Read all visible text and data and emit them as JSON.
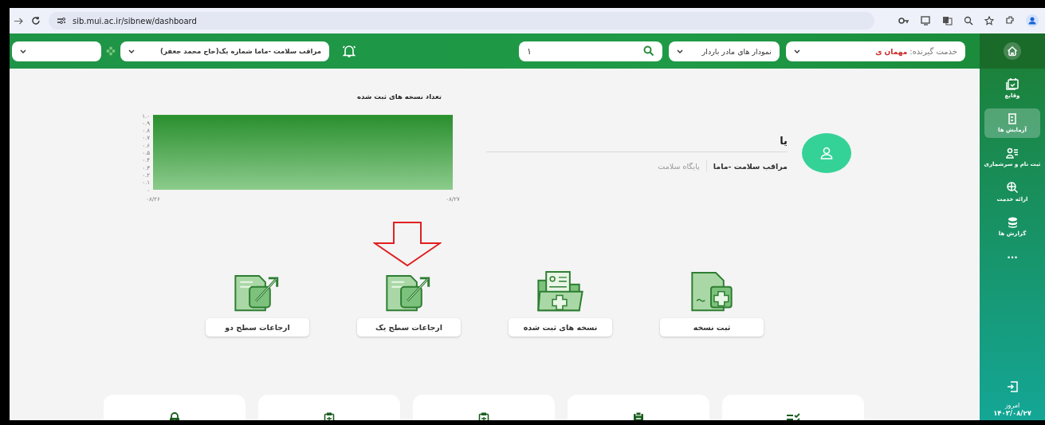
{
  "browser": {
    "url": "sib.mui.ac.ir/sibnew/dashboard"
  },
  "header": {
    "client_label": "خدمت گیرنده:",
    "client_value": "مهمان ی",
    "chart_select": "نمودار های مادر باردار",
    "search_value": "۱",
    "role_select": "مراقب سلامت -ماما شماره یک(حاج محمد جعفر)"
  },
  "sidebar": {
    "items": [
      {
        "label": "وقایع",
        "kind": "calendar",
        "selected": false
      },
      {
        "label": "آزمایش ها",
        "kind": "tube",
        "selected": true
      },
      {
        "label": "ثبت نام و سرشماری",
        "kind": "people",
        "selected": false
      },
      {
        "label": "ارائه خدمت",
        "kind": "globe",
        "selected": false
      },
      {
        "label": "گزارش ها",
        "kind": "database",
        "selected": false
      }
    ],
    "more": "...",
    "date_label": "امروز",
    "date": "۱۴۰۳/۰۸/۲۷"
  },
  "chart": {
    "chart_data": {
      "type": "area",
      "title": "تعداد نسخه های ثبت شده",
      "categories": [
        "۰۸/۲۶",
        "۰۸/۲۷"
      ],
      "series": [
        {
          "color": "#2e9632",
          "values": [
            1,
            1
          ]
        }
      ],
      "ylim": [
        0,
        1
      ],
      "yticks": [
        {
          "value": 0,
          "label": "۰"
        },
        {
          "value": 0.1,
          "label": "۰.۱"
        },
        {
          "value": 0.2,
          "label": "۰.۲"
        },
        {
          "value": 0.3,
          "label": "۰.۳"
        },
        {
          "value": 0.4,
          "label": "۰.۴"
        },
        {
          "value": 0.5,
          "label": "۰.۵"
        },
        {
          "value": 0.6,
          "label": "۰.۶"
        },
        {
          "value": 0.7,
          "label": "۰.۷"
        },
        {
          "value": 0.8,
          "label": "۰.۸"
        },
        {
          "value": 0.9,
          "label": "۰.۹"
        },
        {
          "value": 1,
          "label": "۱.۰"
        }
      ]
    }
  },
  "profile": {
    "name": "یا",
    "role": "مراقب سلامت -ماما",
    "unit": "پایگاه سلامت"
  },
  "actions": [
    {
      "label": "ثبت نسخه",
      "kind": "prescription",
      "annotated": false
    },
    {
      "label": "نسخه های ثبت شده",
      "kind": "folder",
      "annotated": false
    },
    {
      "label": "ارجاعات سطح یک",
      "kind": "referral",
      "annotated": true
    },
    {
      "label": "ارجاعات سطح دو",
      "kind": "referral",
      "annotated": false
    }
  ],
  "bottom_cards": [
    {
      "kind": "checklist"
    },
    {
      "kind": "clipboard-filled"
    },
    {
      "kind": "clipboard"
    },
    {
      "kind": "clipboard"
    },
    {
      "kind": "lock"
    }
  ]
}
